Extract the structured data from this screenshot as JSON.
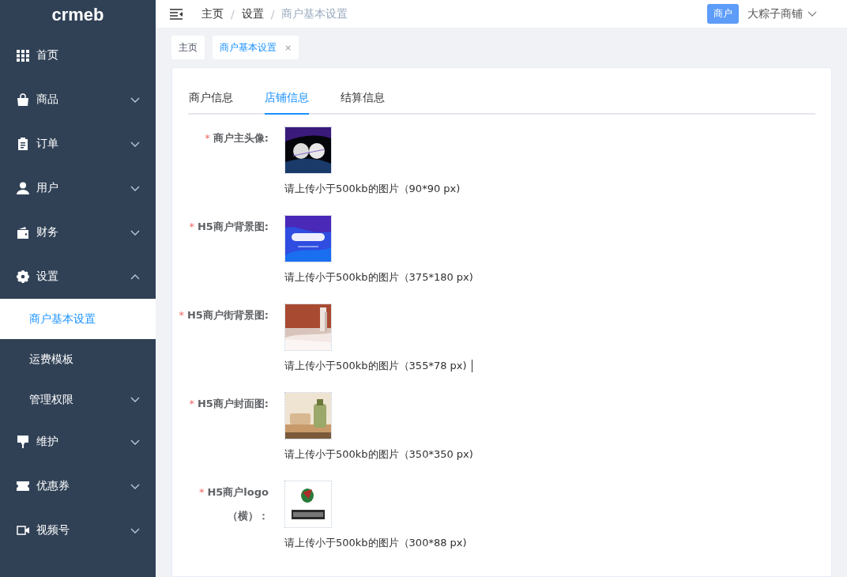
{
  "sidebar": {
    "logo": "crmeb",
    "items": [
      {
        "label": "首页"
      },
      {
        "label": "商品",
        "expanded": false,
        "has_children": true
      },
      {
        "label": "订单",
        "expanded": false,
        "has_children": true
      },
      {
        "label": "用户",
        "expanded": false,
        "has_children": true
      },
      {
        "label": "财务",
        "expanded": false,
        "has_children": true
      },
      {
        "label": "设置",
        "expanded": true,
        "has_children": true,
        "children": [
          {
            "label": "商户基本设置",
            "selected": true
          },
          {
            "label": "运费模板",
            "selected": false
          },
          {
            "label": "管理权限",
            "selected": false,
            "has_children": true
          }
        ]
      },
      {
        "label": "维护",
        "expanded": false,
        "has_children": true
      },
      {
        "label": "优惠券",
        "expanded": false,
        "has_children": true
      },
      {
        "label": "视频号",
        "expanded": false,
        "has_children": true
      }
    ]
  },
  "header": {
    "breadcrumb": [
      "主页",
      "设置",
      "商户基本设置"
    ],
    "separator": "/",
    "role_badge": "商户",
    "store_name": "大粽子商铺"
  },
  "page_tabs": [
    {
      "label": "主页",
      "selected": false,
      "closable": false
    },
    {
      "label": "商户基本设置",
      "selected": true,
      "closable": true,
      "close_glyph": "×"
    }
  ],
  "tabs": [
    {
      "label": "商户信息",
      "selected": false
    },
    {
      "label": "店铺信息",
      "selected": true
    },
    {
      "label": "结算信息",
      "selected": false
    }
  ],
  "form": [
    {
      "label": "商户主头像:",
      "required_mark": "*",
      "hint": "请上传小于500kb的图片（90*90 px)"
    },
    {
      "label": "H5商户背景图:",
      "required_mark": "*",
      "hint": "请上传小于500kb的图片（375*180 px)"
    },
    {
      "label": "H5商户街背景图:",
      "required_mark": "*",
      "hint": "请上传小于500kb的图片（355*78 px)",
      "cursor": true
    },
    {
      "label": "H5商户封面图:",
      "required_mark": "*",
      "hint": "请上传小于500kb的图片（350*350 px)"
    },
    {
      "label": "H5商户logo（横）：",
      "required_mark": "*",
      "hint": "请上传小于500kb的图片（300*88 px)"
    }
  ]
}
